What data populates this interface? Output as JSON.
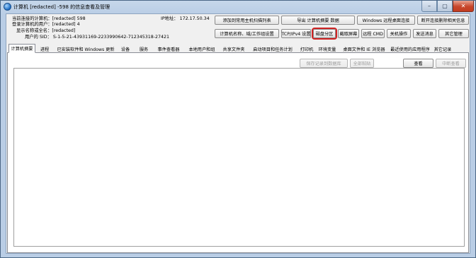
{
  "window": {
    "title": "计算机 [redacted] -598 的信息查看及管理",
    "controls": {
      "minimize": "–",
      "maximize": "▢",
      "close": "✕"
    }
  },
  "info": {
    "current_computer_label": "当前连接的计算机：",
    "current_computer_value": "[redacted] 598",
    "logged_user_label": "登录计算机的用户：",
    "logged_user_value": "[redacted] 4",
    "display_name_label": "显示名称或全名：",
    "display_name_value": "[redacted]",
    "user_sid_label": "用户的 SID：",
    "user_sid_value": "S-1-5-21-43931169-2233990642-712345318-27421",
    "ip_label": "IP地址：",
    "ip_value": "172.17.50.34"
  },
  "buttons": {
    "add_frequent": "添加到常用主机扫描列表",
    "export_data": "导出 计算机摘要 数据",
    "remote_desktop": "Windows 远程桌面连接",
    "disconnect": "断开连接删除相关信息",
    "computer_name": "计算机名称、域/工作组设置",
    "tcp_ipv4": "TCP/IPv4 设置",
    "disk_partition": "磁盘分区",
    "screenshot": "截取屏幕",
    "remote_cmd": "远程 CMD",
    "shutdown": "关机操作",
    "send_message": "发送消息",
    "other_management": "其它管理",
    "save_record": "保存记录到数据库",
    "select_all": "全部粘贴",
    "view": "查看",
    "stop_view": "中断查看"
  },
  "tabs": [
    "计算机摘要",
    "进程",
    "已安装软件和 Windows 更新",
    "设备",
    "服务",
    "事件查看器",
    "本地用户和组",
    "共享文件夹",
    "启动项目和任务计划",
    "打印机",
    "环境变量",
    "桌面文件和 IE 浏览器",
    "最近使用的应用程序",
    "其它记录"
  ]
}
